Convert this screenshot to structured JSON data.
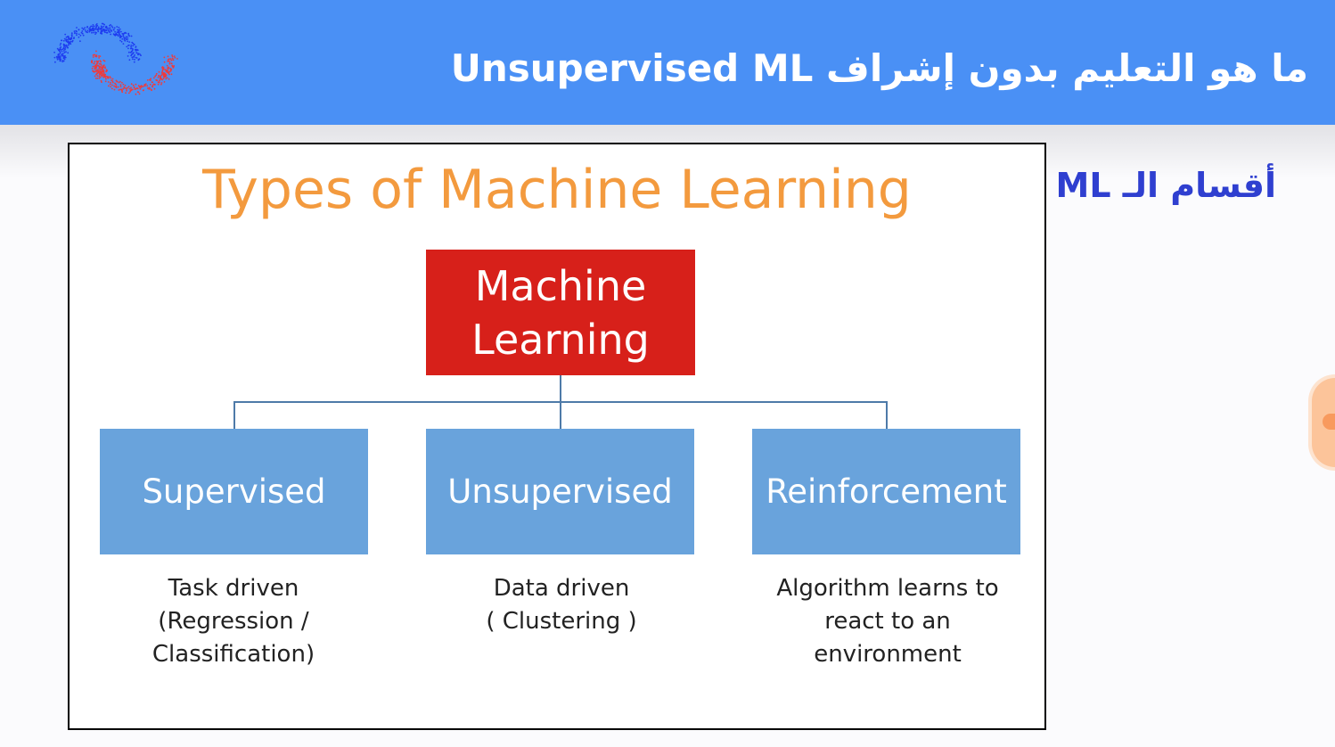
{
  "header": {
    "title": "ما هو التعليم بدون إشراف Unsupervised ML",
    "logo_colors": [
      "#1e3cf0",
      "#f03a3a"
    ]
  },
  "side_heading": "أقسام الـ ML :",
  "slide": {
    "title": "Types of Machine Learning",
    "root": "Machine Learning",
    "children": [
      {
        "label": "Supervised",
        "description": [
          "Task driven",
          "(Regression /",
          "Classification)"
        ]
      },
      {
        "label": "Unsupervised",
        "description": [
          "Data driven",
          "( Clustering )"
        ]
      },
      {
        "label": "Reinforcement",
        "description": [
          "Algorithm learns to",
          "react to an",
          "environment"
        ]
      }
    ]
  },
  "colors": {
    "header": "#4a90f5",
    "title": "#f39a3e",
    "root": "#d7201a",
    "child": "#69a3dc",
    "side": "#2f3fd0"
  }
}
